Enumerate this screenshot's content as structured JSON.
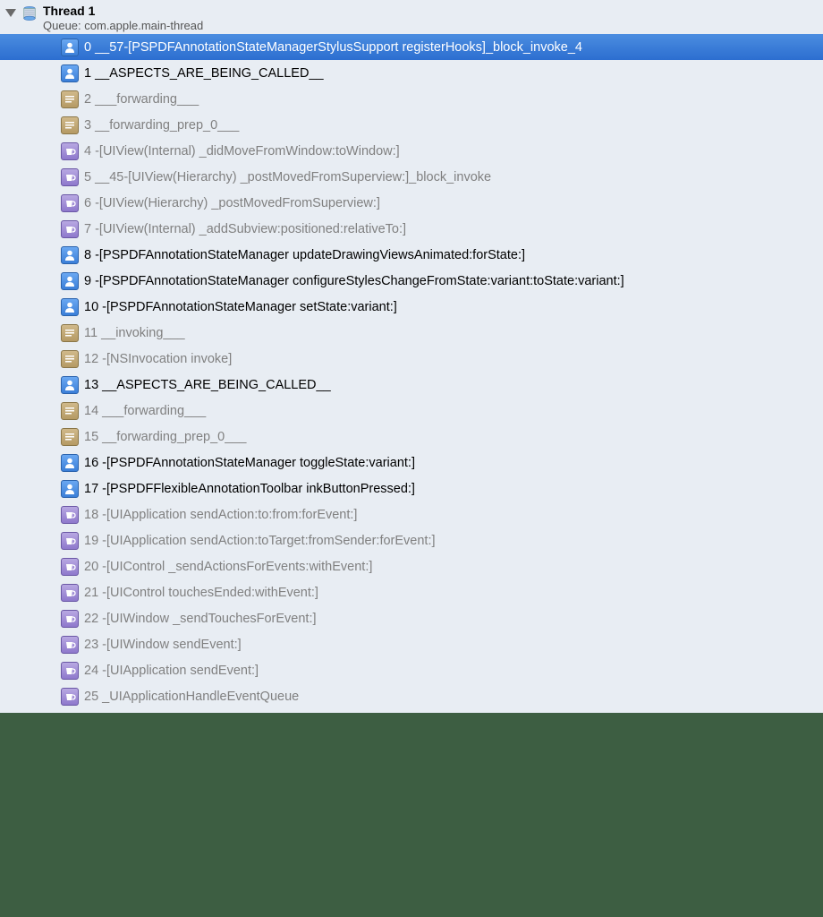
{
  "thread": {
    "title": "Thread 1",
    "subtitle": "Queue: com.apple.main-thread"
  },
  "frames": [
    {
      "num": "0",
      "label": "__57-[PSPDFAnnotationStateManagerStylusSupport registerHooks]_block_invoke_4",
      "icon": "user",
      "emph": true,
      "selected": true
    },
    {
      "num": "1",
      "label": "__ASPECTS_ARE_BEING_CALLED__",
      "icon": "user",
      "emph": true
    },
    {
      "num": "2",
      "label": "___forwarding___",
      "icon": "assembly",
      "emph": false
    },
    {
      "num": "3",
      "label": "__forwarding_prep_0___",
      "icon": "assembly",
      "emph": false
    },
    {
      "num": "4",
      "label": "-[UIView(Internal) _didMoveFromWindow:toWindow:]",
      "icon": "cup",
      "emph": false
    },
    {
      "num": "5",
      "label": "__45-[UIView(Hierarchy) _postMovedFromSuperview:]_block_invoke",
      "icon": "cup",
      "emph": false
    },
    {
      "num": "6",
      "label": "-[UIView(Hierarchy) _postMovedFromSuperview:]",
      "icon": "cup",
      "emph": false
    },
    {
      "num": "7",
      "label": "-[UIView(Internal) _addSubview:positioned:relativeTo:]",
      "icon": "cup",
      "emph": false
    },
    {
      "num": "8",
      "label": "-[PSPDFAnnotationStateManager updateDrawingViewsAnimated:forState:]",
      "icon": "user",
      "emph": true
    },
    {
      "num": "9",
      "label": "-[PSPDFAnnotationStateManager configureStylesChangeFromState:variant:toState:variant:]",
      "icon": "user",
      "emph": true
    },
    {
      "num": "10",
      "label": "-[PSPDFAnnotationStateManager setState:variant:]",
      "icon": "user",
      "emph": true
    },
    {
      "num": "11",
      "label": "__invoking___",
      "icon": "assembly",
      "emph": false
    },
    {
      "num": "12",
      "label": "-[NSInvocation invoke]",
      "icon": "assembly",
      "emph": false
    },
    {
      "num": "13",
      "label": "__ASPECTS_ARE_BEING_CALLED__",
      "icon": "user",
      "emph": true
    },
    {
      "num": "14",
      "label": "___forwarding___",
      "icon": "assembly",
      "emph": false
    },
    {
      "num": "15",
      "label": "__forwarding_prep_0___",
      "icon": "assembly",
      "emph": false
    },
    {
      "num": "16",
      "label": "-[PSPDFAnnotationStateManager toggleState:variant:]",
      "icon": "user",
      "emph": true
    },
    {
      "num": "17",
      "label": "-[PSPDFFlexibleAnnotationToolbar inkButtonPressed:]",
      "icon": "user",
      "emph": true
    },
    {
      "num": "18",
      "label": "-[UIApplication sendAction:to:from:forEvent:]",
      "icon": "cup",
      "emph": false
    },
    {
      "num": "19",
      "label": "-[UIApplication sendAction:toTarget:fromSender:forEvent:]",
      "icon": "cup",
      "emph": false
    },
    {
      "num": "20",
      "label": "-[UIControl _sendActionsForEvents:withEvent:]",
      "icon": "cup",
      "emph": false
    },
    {
      "num": "21",
      "label": "-[UIControl touchesEnded:withEvent:]",
      "icon": "cup",
      "emph": false
    },
    {
      "num": "22",
      "label": "-[UIWindow _sendTouchesForEvent:]",
      "icon": "cup",
      "emph": false
    },
    {
      "num": "23",
      "label": "-[UIWindow sendEvent:]",
      "icon": "cup",
      "emph": false
    },
    {
      "num": "24",
      "label": "-[UIApplication sendEvent:]",
      "icon": "cup",
      "emph": false
    },
    {
      "num": "25",
      "label": "_UIApplicationHandleEventQueue",
      "icon": "cup",
      "emph": false
    }
  ]
}
